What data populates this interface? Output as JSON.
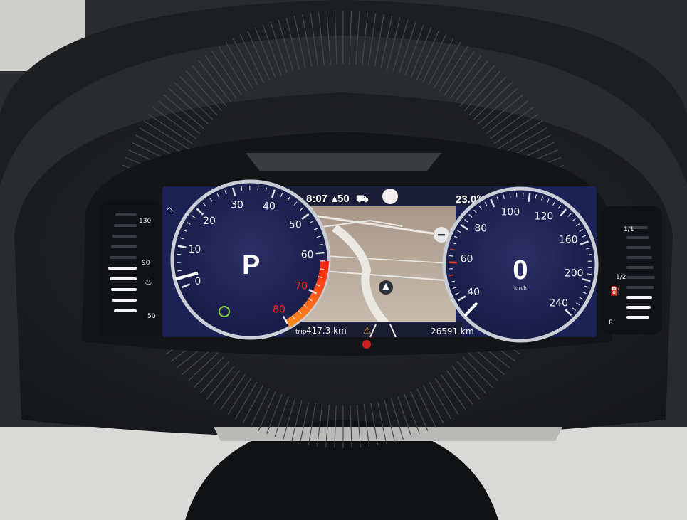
{
  "status_bar": {
    "time": "8:07",
    "navigation_distance": "50",
    "outside_temperature": "23.0°C"
  },
  "tachometer": {
    "scale_labels": [
      "0",
      "10",
      "20",
      "30",
      "40",
      "50",
      "60",
      "70",
      "80"
    ],
    "redline_labels": [
      "70",
      "80"
    ],
    "gear": "P",
    "eco_indicator": "eco-leaf-icon"
  },
  "speedometer": {
    "scale_labels": [
      "40",
      "60",
      "80",
      "100",
      "120",
      "160",
      "200",
      "240"
    ],
    "speed": "0",
    "unit": "km/h"
  },
  "bottom_bar": {
    "trip_label": "trip",
    "trip_value": "417.3 km",
    "odometer": "26591 km"
  },
  "coolant_gauge": {
    "scale_labels": [
      "130",
      "90",
      "50"
    ],
    "level": 0.55
  },
  "fuel_gauge": {
    "scale_labels": [
      "1/1",
      "1/2",
      "R"
    ],
    "level": 0.35
  },
  "colors": {
    "screen_background": "#1b2150",
    "ring": "#c9ced6",
    "redline": "#e8231c",
    "map_road": "#e8e6e2",
    "map_bg": "#b6a898"
  }
}
